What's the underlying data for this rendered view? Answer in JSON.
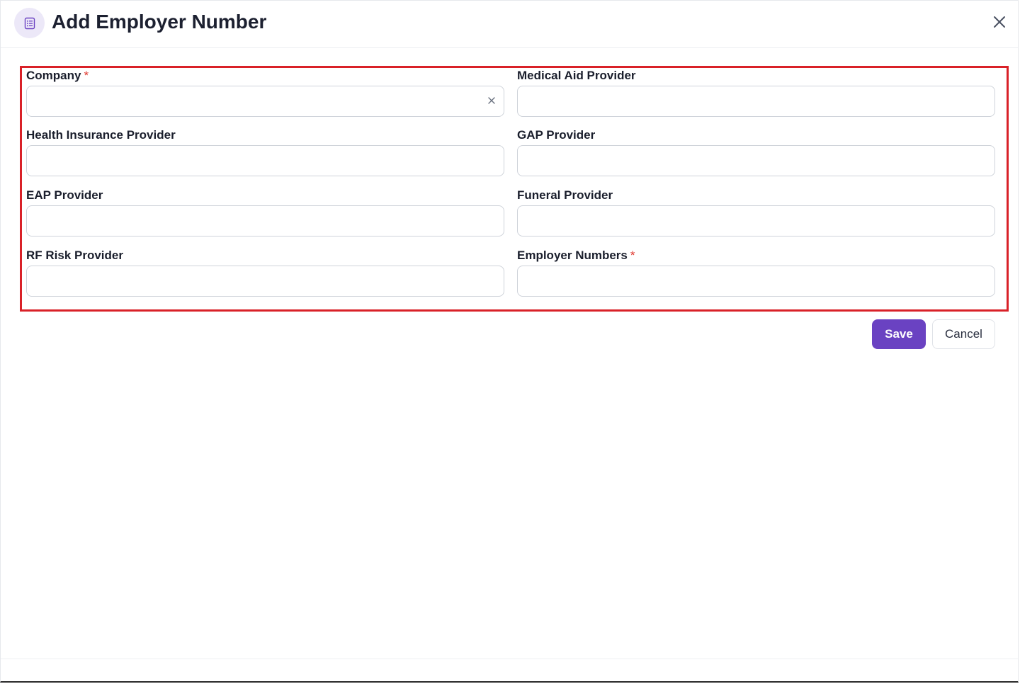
{
  "dialog": {
    "title": "Add Employer Number",
    "title_icon": "document-list-icon",
    "close_icon": "close-icon"
  },
  "form": {
    "required_marker": "*",
    "company": {
      "label": "Company",
      "value": "",
      "required": true,
      "clear_icon": "clear-icon"
    },
    "medical_aid_provider": {
      "label": "Medical Aid Provider",
      "value": ""
    },
    "health_insurance_provider": {
      "label": "Health Insurance Provider",
      "value": ""
    },
    "gap_provider": {
      "label": "GAP Provider",
      "value": ""
    },
    "eap_provider": {
      "label": "EAP Provider",
      "value": ""
    },
    "funeral_provider": {
      "label": "Funeral Provider",
      "value": ""
    },
    "rf_risk_provider": {
      "label": "RF Risk Provider",
      "value": ""
    },
    "employer_numbers": {
      "label": "Employer Numbers",
      "value": "",
      "required": true
    }
  },
  "actions": {
    "save_label": "Save",
    "cancel_label": "Cancel"
  },
  "colors": {
    "accent": "#6a42c2",
    "required": "#e0392f",
    "highlight_border": "#d92128",
    "icon_bg": "#ece8f8"
  }
}
